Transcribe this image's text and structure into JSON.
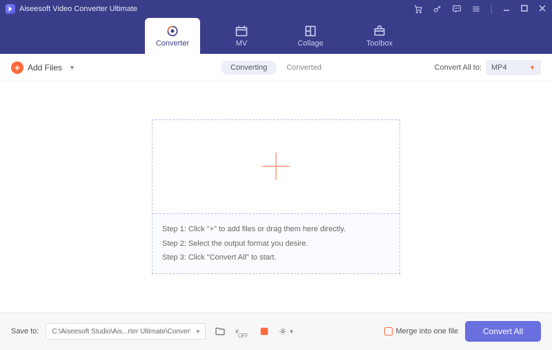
{
  "titlebar": {
    "title": "Aiseesoft Video Converter Ultimate"
  },
  "nav": {
    "tabs": [
      {
        "label": "Converter"
      },
      {
        "label": "MV"
      },
      {
        "label": "Collage"
      },
      {
        "label": "Toolbox"
      }
    ]
  },
  "toolbar": {
    "add_files_label": "Add Files",
    "seg_converting": "Converting",
    "seg_converted": "Converted",
    "convert_all_to_label": "Convert All to:",
    "format_selected": "MP4"
  },
  "dropzone": {
    "step1": "Step 1: Click \"+\" to add files or drag them here directly.",
    "step2": "Step 2: Select the output format you desire.",
    "step3": "Step 3: Click \"Convert All\" to start."
  },
  "bottombar": {
    "save_to_label": "Save to:",
    "path": "C:\\Aiseesoft Studio\\Ais...rter Ultimate\\Converted",
    "merge_label": "Merge into one file",
    "convert_all_button": "Convert All"
  }
}
